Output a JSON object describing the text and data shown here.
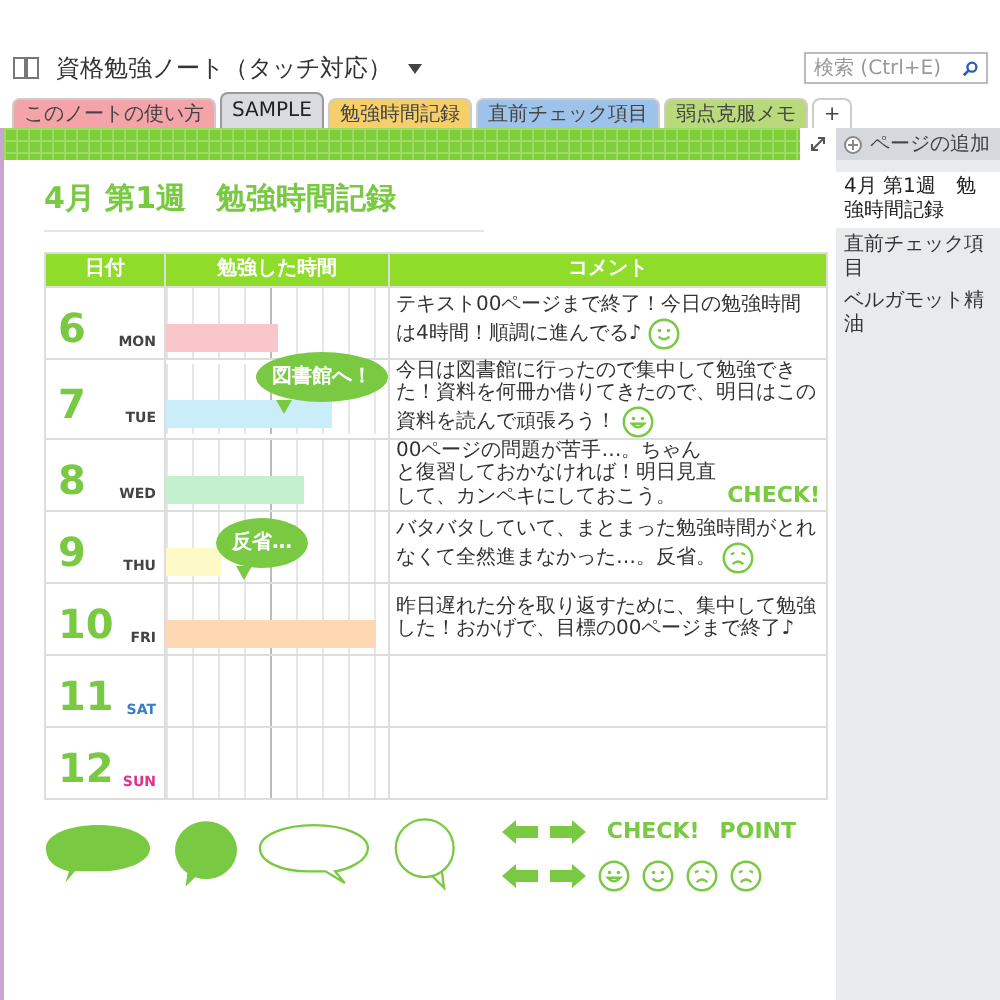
{
  "notebook": {
    "title": "資格勉強ノート（タッチ対応）"
  },
  "tabs": [
    {
      "label": "このノートの使い方",
      "color": "#f4a3a8",
      "selected": false
    },
    {
      "label": "SAMPLE",
      "color": "#d9dbe0",
      "selected": true
    },
    {
      "label": "勉強時間記録",
      "color": "#f7cf6a",
      "selected": false
    },
    {
      "label": "直前チェック項目",
      "color": "#9ec3ea",
      "selected": false
    },
    {
      "label": "弱点克服メモ",
      "color": "#b9d97a",
      "selected": false
    },
    {
      "label": "+",
      "color": "#ffffff",
      "selected": false
    }
  ],
  "search": {
    "placeholder": "検索 (Ctrl+E)"
  },
  "page": {
    "heading": "4月 第1週　勉強時間記録"
  },
  "table": {
    "columns": [
      "日付",
      "勉強した時間",
      "コメント"
    ],
    "rows": [
      {
        "day": "6",
        "weekday": "MON",
        "kind": "weekday",
        "bar": {
          "color": "#f9c6cc",
          "level": 0.5
        },
        "comment": {
          "text": "テキスト00ページまで終了！今日の勉強時間は4時間！順調に進んでる♪",
          "kind": "smile"
        }
      },
      {
        "day": "7",
        "weekday": "TUE",
        "kind": "weekday",
        "bar": {
          "color": "#c9eefa",
          "level": 0.75
        },
        "comment": {
          "text": "今日は図書館に行ったので集中して勉強できた！資料を何冊か借りてきたので、明日はこの資料を読んで頑張ろう！",
          "kind": "grin"
        }
      },
      {
        "day": "8",
        "weekday": "WED",
        "kind": "weekday",
        "bar": {
          "color": "#c4f0cf",
          "level": 0.62
        },
        "comment": {
          "text": "00ページの問題が苦手…。ちゃんと復習しておかなければ！明日見直して、カンペキにしておこう。",
          "kind": "tag",
          "tag": "CHECK!"
        }
      },
      {
        "day": "9",
        "weekday": "THU",
        "kind": "weekday",
        "bar": {
          "color": "#fdfac8",
          "level": 0.25
        },
        "comment": {
          "text": "バタバタしていて、まとまった勉強時間がとれなくて全然進まなかった…。反省。",
          "kind": "sad"
        }
      },
      {
        "day": "10",
        "weekday": "FRI",
        "kind": "weekday",
        "bar": {
          "color": "#fdd8b2",
          "level": 0.95
        },
        "comment": {
          "text": "昨日遅れた分を取り返すために、集中して勉強した！おかげで、目標の00ページまで終了♪",
          "kind": "plain"
        }
      },
      {
        "day": "11",
        "weekday": "SAT",
        "kind": "saturday"
      },
      {
        "day": "12",
        "weekday": "SUN",
        "kind": "sunday"
      }
    ],
    "callouts": [
      "図書館へ！",
      "反省…"
    ]
  },
  "stickers": {
    "labels": [
      "CHECK!",
      "POINT"
    ]
  },
  "sidebar": {
    "add_page": "ページの追加",
    "pages": [
      {
        "label": "4月 第1週　勉強時間記録",
        "selected": true
      },
      {
        "label": "直前チェック項目",
        "selected": false
      },
      {
        "label": "ベルガモット精油",
        "selected": false
      }
    ]
  }
}
